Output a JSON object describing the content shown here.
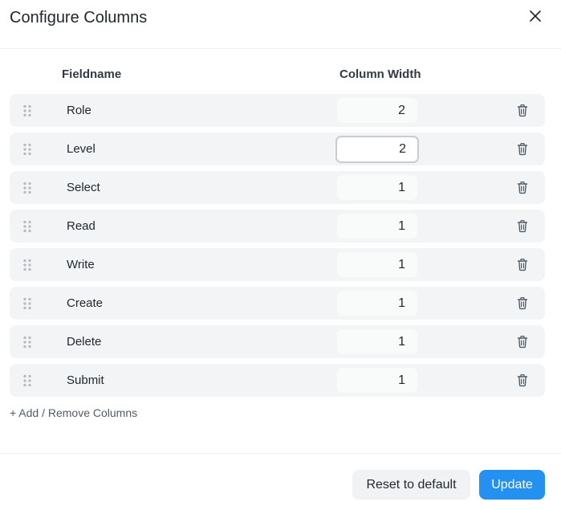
{
  "dialog": {
    "title": "Configure Columns",
    "close_icon": "close-icon"
  },
  "table": {
    "headers": {
      "fieldname": "Fieldname",
      "column_width": "Column Width"
    },
    "rows": [
      {
        "label": "Role",
        "width": "2"
      },
      {
        "label": "Level",
        "width": "2"
      },
      {
        "label": "Select",
        "width": "1"
      },
      {
        "label": "Read",
        "width": "1"
      },
      {
        "label": "Write",
        "width": "1"
      },
      {
        "label": "Create",
        "width": "1"
      },
      {
        "label": "Delete",
        "width": "1"
      },
      {
        "label": "Submit",
        "width": "1"
      }
    ],
    "focused_row": "Level"
  },
  "add_remove_label": "+ Add / Remove Columns",
  "footer": {
    "reset_label": "Reset to default",
    "update_label": "Update"
  },
  "colors": {
    "primary": "#2490ef",
    "row_bg": "#f3f4f6",
    "text": "#1f272e"
  }
}
